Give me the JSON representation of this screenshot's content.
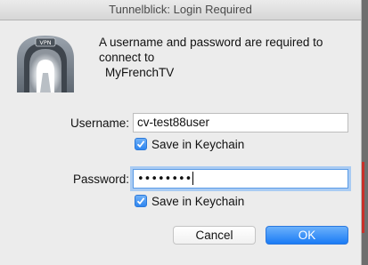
{
  "window": {
    "title": "Tunnelblick: Login Required"
  },
  "icon": {
    "name": "tunnelblick-icon",
    "badge_text": "VPN"
  },
  "message": {
    "line1": "A username and password are required to",
    "line2": "connect to",
    "configuration": "MyFrenchTV"
  },
  "username": {
    "label": "Username:",
    "value": "cv-test88user",
    "save_label": "Save in Keychain",
    "save_checked": true
  },
  "password": {
    "label": "Password:",
    "masked_value": "••••••••",
    "save_label": "Save in Keychain",
    "save_checked": true
  },
  "buttons": {
    "cancel": "Cancel",
    "ok": "OK"
  },
  "colors": {
    "accent": "#1a7bf5",
    "window_bg": "#ececec"
  }
}
